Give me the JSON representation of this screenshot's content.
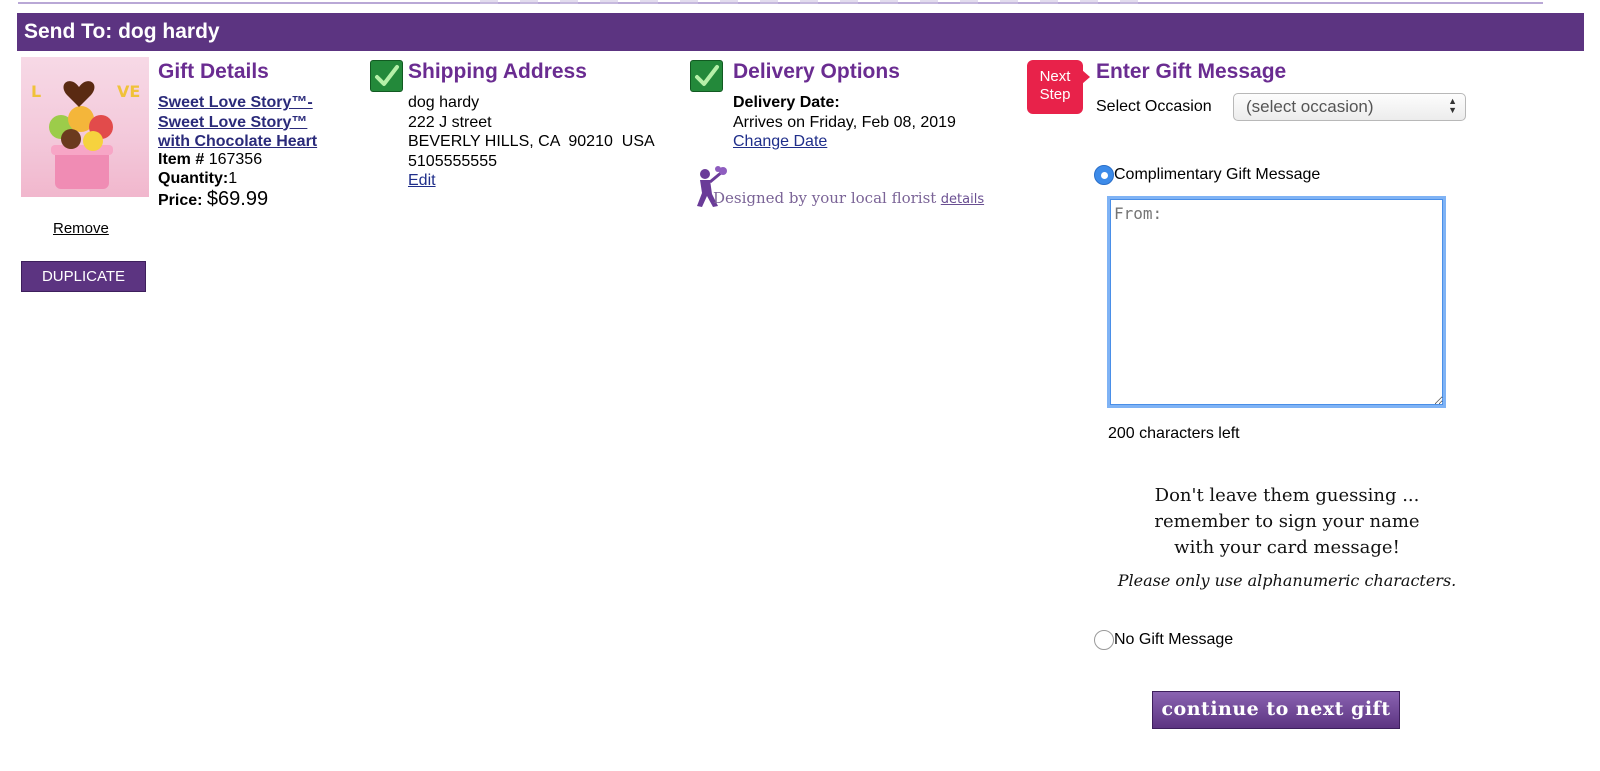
{
  "header": {
    "title": "Send To: dog hardy"
  },
  "gift_details": {
    "title": "Gift Details",
    "product_link": "Sweet Love Story™- Sweet Love Story™ with Chocolate Heart",
    "product_link_lines": [
      "Sweet Love Story™-",
      "Sweet Love Story™",
      "with Chocolate Heart"
    ],
    "item_label": "Item #",
    "item_value": "167356",
    "quantity_label": "Quantity:",
    "quantity_value": "1",
    "price_label": "Price:",
    "price_value": "$69.99",
    "remove_label": "Remove",
    "duplicate_label": "DUPLICATE"
  },
  "shipping": {
    "title": "Shipping Address",
    "name": "dog hardy",
    "street": "222 J street",
    "city_line": "BEVERLY HILLS, CA  90210  USA",
    "phone": "5105555555",
    "edit_label": "Edit"
  },
  "delivery": {
    "title": "Delivery Options",
    "date_label": "Delivery Date:",
    "arrives_text": "Arrives on Friday, Feb 08, 2019",
    "change_label": "Change Date",
    "florist_text": "Designed by your local florist",
    "florist_details": "details"
  },
  "gift_message": {
    "next_step_lines": [
      "Next",
      "Step"
    ],
    "title": "Enter Gift Message",
    "occasion_label": "Select Occasion",
    "occasion_selected": "(select occasion)",
    "complimentary_label": "Complimentary Gift Message",
    "complimentary_selected": true,
    "textarea_placeholder": "From:",
    "chars_left": "200 characters left",
    "reminder_lines": [
      "Don't leave them guessing ...",
      "remember to sign your name",
      "with your card message!"
    ],
    "alnum_note": "Please only use alphanumeric characters.",
    "no_message_label": "No Gift Message",
    "continue_label": "continue to next gift"
  },
  "colors": {
    "brand_purple": "#5c3481",
    "title_purple": "#6a2c91",
    "check_green": "#23893a",
    "next_step_red": "#e8224a",
    "radio_blue": "#3d8be9"
  },
  "icons": {
    "check": "checkmark-icon",
    "florist": "florist-figure-icon",
    "select_arrows": "updown-arrows-icon"
  }
}
